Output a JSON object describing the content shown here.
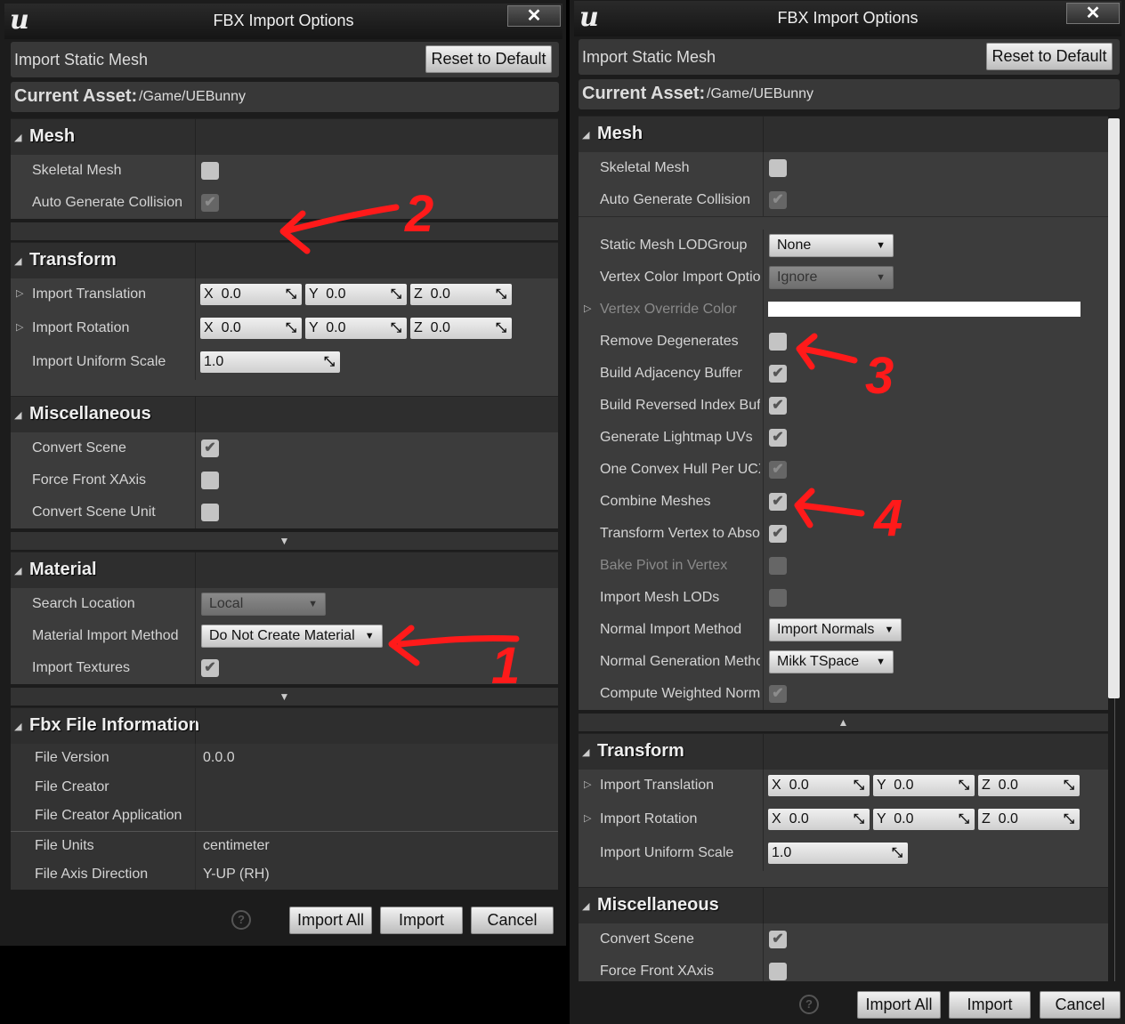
{
  "panels": [
    {
      "title": "FBX Import Options",
      "logo": "u",
      "close_icon": "close-icon",
      "header": {
        "label": "Import Static Mesh",
        "reset_label": "Reset to Default"
      },
      "current_asset": {
        "label": "Current Asset:",
        "value": "/Game/UEBunny"
      },
      "sections": [
        {
          "title": "Mesh",
          "expander": "down",
          "rows": [
            {
              "label": "Skeletal Mesh",
              "type": "checkbox",
              "checked": false,
              "enabled": true
            },
            {
              "label": "Auto Generate Collision",
              "type": "checkbox",
              "checked": true,
              "enabled": false
            }
          ]
        },
        {
          "title": "Transform",
          "expander": null,
          "rows": [
            {
              "label": "Import Translation",
              "type": "vector",
              "expandable": true,
              "values": {
                "x": "0.0",
                "y": "0.0",
                "z": "0.0"
              }
            },
            {
              "label": "Import Rotation",
              "type": "vector",
              "expandable": true,
              "values": {
                "x": "0.0",
                "y": "0.0",
                "z": "0.0"
              }
            },
            {
              "label": "Import Uniform Scale",
              "type": "scalar",
              "value": "1.0"
            }
          ]
        },
        {
          "title": "Miscellaneous",
          "expander": "down",
          "rows": [
            {
              "label": "Convert Scene",
              "type": "checkbox",
              "checked": true,
              "enabled": true
            },
            {
              "label": "Force Front XAxis",
              "type": "checkbox",
              "checked": false,
              "enabled": true
            },
            {
              "label": "Convert Scene Unit",
              "type": "checkbox",
              "checked": false,
              "enabled": true
            }
          ]
        },
        {
          "title": "Material",
          "expander": "down",
          "rows": [
            {
              "label": "Search Location",
              "type": "dropdown",
              "value": "Local",
              "enabled": false
            },
            {
              "label": "Material Import Method",
              "type": "dropdown",
              "value": "Do Not Create Material",
              "enabled": true
            },
            {
              "label": "Import Textures",
              "type": "checkbox",
              "checked": true,
              "enabled": true
            }
          ]
        },
        {
          "title": "Fbx File Information",
          "expander": null,
          "rows": [
            {
              "label": "File Version",
              "type": "info",
              "value": "0.0.0"
            },
            {
              "label": "File Creator",
              "type": "info",
              "value": ""
            },
            {
              "label": "File Creator Application",
              "type": "info",
              "value": ""
            },
            {
              "label": "File Units",
              "type": "info",
              "value": "centimeter"
            },
            {
              "label": "File Axis Direction",
              "type": "info",
              "value": "Y-UP (RH)"
            }
          ]
        }
      ],
      "footer": {
        "help_icon": "help-icon",
        "buttons": [
          "Import All",
          "Import",
          "Cancel"
        ]
      }
    },
    {
      "title": "FBX Import Options",
      "logo": "u",
      "close_icon": "close-icon",
      "header": {
        "label": "Import Static Mesh",
        "reset_label": "Reset to Default"
      },
      "current_asset": {
        "label": "Current Asset:",
        "value": "/Game/UEBunny"
      },
      "sections": [
        {
          "title": "Mesh",
          "expander": "up",
          "rows": [
            {
              "label": "Skeletal Mesh",
              "type": "checkbox",
              "checked": false,
              "enabled": true
            },
            {
              "label": "Auto Generate Collision",
              "type": "checkbox",
              "checked": true,
              "enabled": false
            }
          ],
          "advanced_rows": [
            {
              "label": "Static Mesh LODGroup",
              "type": "dropdown",
              "value": "None",
              "enabled": true
            },
            {
              "label": "Vertex Color Import Option",
              "type": "dropdown",
              "value": "Ignore",
              "enabled": false
            },
            {
              "label": "Vertex Override Color",
              "type": "color",
              "value": "#ffffff",
              "expandable": true,
              "label_disabled": true
            },
            {
              "label": "Remove Degenerates",
              "type": "checkbox",
              "checked": false,
              "enabled": true
            },
            {
              "label": "Build Adjacency Buffer",
              "type": "checkbox",
              "checked": true,
              "enabled": true
            },
            {
              "label": "Build Reversed Index Buffer",
              "type": "checkbox",
              "checked": true,
              "enabled": true
            },
            {
              "label": "Generate Lightmap UVs",
              "type": "checkbox",
              "checked": true,
              "enabled": true
            },
            {
              "label": "One Convex Hull Per UCX",
              "type": "checkbox",
              "checked": true,
              "enabled": false
            },
            {
              "label": "Combine Meshes",
              "type": "checkbox",
              "checked": true,
              "enabled": true
            },
            {
              "label": "Transform Vertex to Absolute",
              "type": "checkbox",
              "checked": true,
              "enabled": true
            },
            {
              "label": "Bake Pivot in Vertex",
              "type": "checkbox",
              "checked": false,
              "enabled": false,
              "label_disabled": true
            },
            {
              "label": "Import Mesh LODs",
              "type": "checkbox",
              "checked": false,
              "enabled": false
            },
            {
              "label": "Normal Import Method",
              "type": "dropdown",
              "value": "Import Normals",
              "enabled": true
            },
            {
              "label": "Normal Generation Method",
              "type": "dropdown",
              "value": "Mikk TSpace",
              "enabled": true
            },
            {
              "label": "Compute Weighted Normals",
              "type": "checkbox",
              "checked": true,
              "enabled": false
            }
          ]
        },
        {
          "title": "Transform",
          "expander": null,
          "rows": [
            {
              "label": "Import Translation",
              "type": "vector",
              "expandable": true,
              "values": {
                "x": "0.0",
                "y": "0.0",
                "z": "0.0"
              }
            },
            {
              "label": "Import Rotation",
              "type": "vector",
              "expandable": true,
              "values": {
                "x": "0.0",
                "y": "0.0",
                "z": "0.0"
              }
            },
            {
              "label": "Import Uniform Scale",
              "type": "scalar",
              "value": "1.0"
            }
          ]
        },
        {
          "title": "Miscellaneous",
          "expander": null,
          "rows": [
            {
              "label": "Convert Scene",
              "type": "checkbox",
              "checked": true,
              "enabled": true
            },
            {
              "label": "Force Front XAxis",
              "type": "checkbox",
              "checked": false,
              "enabled": true
            }
          ]
        }
      ],
      "footer": {
        "help_icon": "help-icon",
        "buttons": [
          "Import All",
          "Import",
          "Cancel"
        ]
      }
    }
  ],
  "annotations": [
    {
      "label": "1",
      "color": "#ff1a1a"
    },
    {
      "label": "2",
      "color": "#ff1a1a"
    },
    {
      "label": "3",
      "color": "#ff1a1a"
    },
    {
      "label": "4",
      "color": "#ff1a1a"
    }
  ]
}
